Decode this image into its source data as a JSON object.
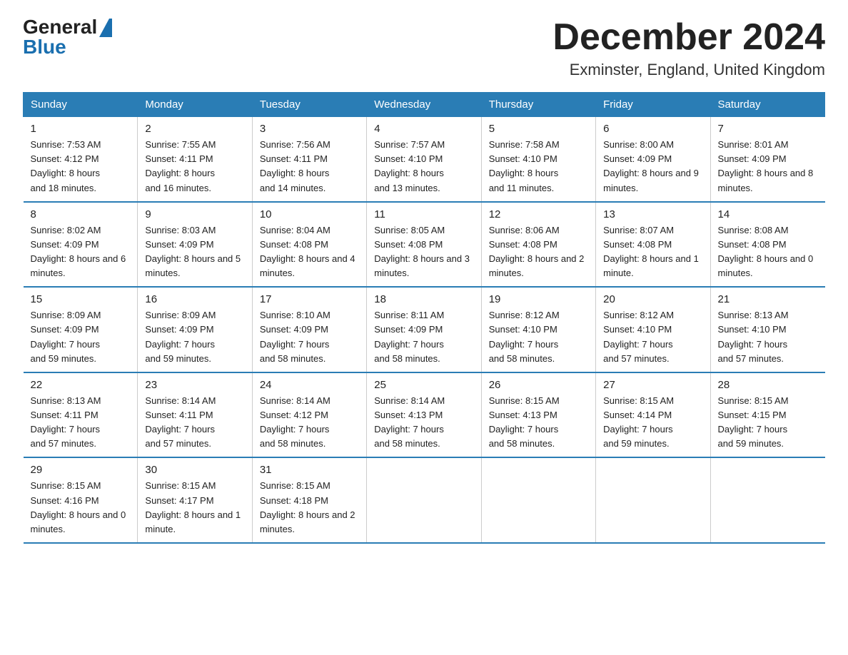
{
  "logo": {
    "general": "General",
    "blue": "Blue"
  },
  "header": {
    "month": "December 2024",
    "location": "Exminster, England, United Kingdom"
  },
  "weekdays": [
    "Sunday",
    "Monday",
    "Tuesday",
    "Wednesday",
    "Thursday",
    "Friday",
    "Saturday"
  ],
  "weeks": [
    [
      {
        "day": "1",
        "sunrise": "7:53 AM",
        "sunset": "4:12 PM",
        "daylight": "8 hours and 18 minutes."
      },
      {
        "day": "2",
        "sunrise": "7:55 AM",
        "sunset": "4:11 PM",
        "daylight": "8 hours and 16 minutes."
      },
      {
        "day": "3",
        "sunrise": "7:56 AM",
        "sunset": "4:11 PM",
        "daylight": "8 hours and 14 minutes."
      },
      {
        "day": "4",
        "sunrise": "7:57 AM",
        "sunset": "4:10 PM",
        "daylight": "8 hours and 13 minutes."
      },
      {
        "day": "5",
        "sunrise": "7:58 AM",
        "sunset": "4:10 PM",
        "daylight": "8 hours and 11 minutes."
      },
      {
        "day": "6",
        "sunrise": "8:00 AM",
        "sunset": "4:09 PM",
        "daylight": "8 hours and 9 minutes."
      },
      {
        "day": "7",
        "sunrise": "8:01 AM",
        "sunset": "4:09 PM",
        "daylight": "8 hours and 8 minutes."
      }
    ],
    [
      {
        "day": "8",
        "sunrise": "8:02 AM",
        "sunset": "4:09 PM",
        "daylight": "8 hours and 6 minutes."
      },
      {
        "day": "9",
        "sunrise": "8:03 AM",
        "sunset": "4:09 PM",
        "daylight": "8 hours and 5 minutes."
      },
      {
        "day": "10",
        "sunrise": "8:04 AM",
        "sunset": "4:08 PM",
        "daylight": "8 hours and 4 minutes."
      },
      {
        "day": "11",
        "sunrise": "8:05 AM",
        "sunset": "4:08 PM",
        "daylight": "8 hours and 3 minutes."
      },
      {
        "day": "12",
        "sunrise": "8:06 AM",
        "sunset": "4:08 PM",
        "daylight": "8 hours and 2 minutes."
      },
      {
        "day": "13",
        "sunrise": "8:07 AM",
        "sunset": "4:08 PM",
        "daylight": "8 hours and 1 minute."
      },
      {
        "day": "14",
        "sunrise": "8:08 AM",
        "sunset": "4:08 PM",
        "daylight": "8 hours and 0 minutes."
      }
    ],
    [
      {
        "day": "15",
        "sunrise": "8:09 AM",
        "sunset": "4:09 PM",
        "daylight": "7 hours and 59 minutes."
      },
      {
        "day": "16",
        "sunrise": "8:09 AM",
        "sunset": "4:09 PM",
        "daylight": "7 hours and 59 minutes."
      },
      {
        "day": "17",
        "sunrise": "8:10 AM",
        "sunset": "4:09 PM",
        "daylight": "7 hours and 58 minutes."
      },
      {
        "day": "18",
        "sunrise": "8:11 AM",
        "sunset": "4:09 PM",
        "daylight": "7 hours and 58 minutes."
      },
      {
        "day": "19",
        "sunrise": "8:12 AM",
        "sunset": "4:10 PM",
        "daylight": "7 hours and 58 minutes."
      },
      {
        "day": "20",
        "sunrise": "8:12 AM",
        "sunset": "4:10 PM",
        "daylight": "7 hours and 57 minutes."
      },
      {
        "day": "21",
        "sunrise": "8:13 AM",
        "sunset": "4:10 PM",
        "daylight": "7 hours and 57 minutes."
      }
    ],
    [
      {
        "day": "22",
        "sunrise": "8:13 AM",
        "sunset": "4:11 PM",
        "daylight": "7 hours and 57 minutes."
      },
      {
        "day": "23",
        "sunrise": "8:14 AM",
        "sunset": "4:11 PM",
        "daylight": "7 hours and 57 minutes."
      },
      {
        "day": "24",
        "sunrise": "8:14 AM",
        "sunset": "4:12 PM",
        "daylight": "7 hours and 58 minutes."
      },
      {
        "day": "25",
        "sunrise": "8:14 AM",
        "sunset": "4:13 PM",
        "daylight": "7 hours and 58 minutes."
      },
      {
        "day": "26",
        "sunrise": "8:15 AM",
        "sunset": "4:13 PM",
        "daylight": "7 hours and 58 minutes."
      },
      {
        "day": "27",
        "sunrise": "8:15 AM",
        "sunset": "4:14 PM",
        "daylight": "7 hours and 59 minutes."
      },
      {
        "day": "28",
        "sunrise": "8:15 AM",
        "sunset": "4:15 PM",
        "daylight": "7 hours and 59 minutes."
      }
    ],
    [
      {
        "day": "29",
        "sunrise": "8:15 AM",
        "sunset": "4:16 PM",
        "daylight": "8 hours and 0 minutes."
      },
      {
        "day": "30",
        "sunrise": "8:15 AM",
        "sunset": "4:17 PM",
        "daylight": "8 hours and 1 minute."
      },
      {
        "day": "31",
        "sunrise": "8:15 AM",
        "sunset": "4:18 PM",
        "daylight": "8 hours and 2 minutes."
      },
      null,
      null,
      null,
      null
    ]
  ],
  "sunrise_label": "Sunrise: ",
  "sunset_label": "Sunset: ",
  "daylight_label": "Daylight: "
}
